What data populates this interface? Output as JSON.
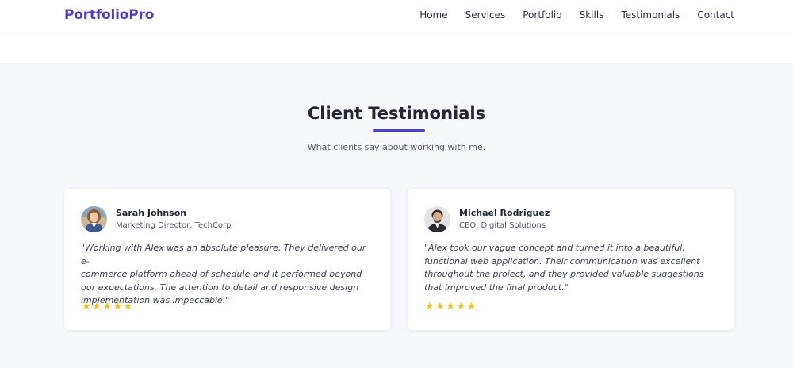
{
  "header": {
    "brand": "PortfolioPro",
    "nav": [
      "Home",
      "Services",
      "Portfolio",
      "Skills",
      "Testimonials",
      "Contact"
    ]
  },
  "section": {
    "title": "Client Testimonials",
    "subtitle": "What clients say about working with me."
  },
  "testimonials": [
    {
      "name": "Sarah Johnson",
      "role": "Marketing Director, TechCorp",
      "quote_lines": [
        "\"Working with Alex was an absolute pleasure. They delivered our e-",
        "commerce platform ahead of schedule and it performed beyond",
        "our expectations. The attention to detail and responsive design",
        "implementation was impeccable.\""
      ],
      "rating": 5,
      "stars": "★★★★★"
    },
    {
      "name": "Michael Rodriguez",
      "role": "CEO, Digital Solutions",
      "quote_lines": [
        "\"Alex took our vague concept and turned it into a beautiful,",
        "functional web application. Their communication was excellent",
        "throughout the project, and they provided valuable suggestions",
        "that improved the final product.\""
      ],
      "rating": 5,
      "stars": "★★★★★"
    }
  ],
  "colors": {
    "brand": "#4f3bd0",
    "accent_underline": "#4a43c9",
    "star": "#f2c016",
    "section_bg": "#f7f8fb"
  }
}
